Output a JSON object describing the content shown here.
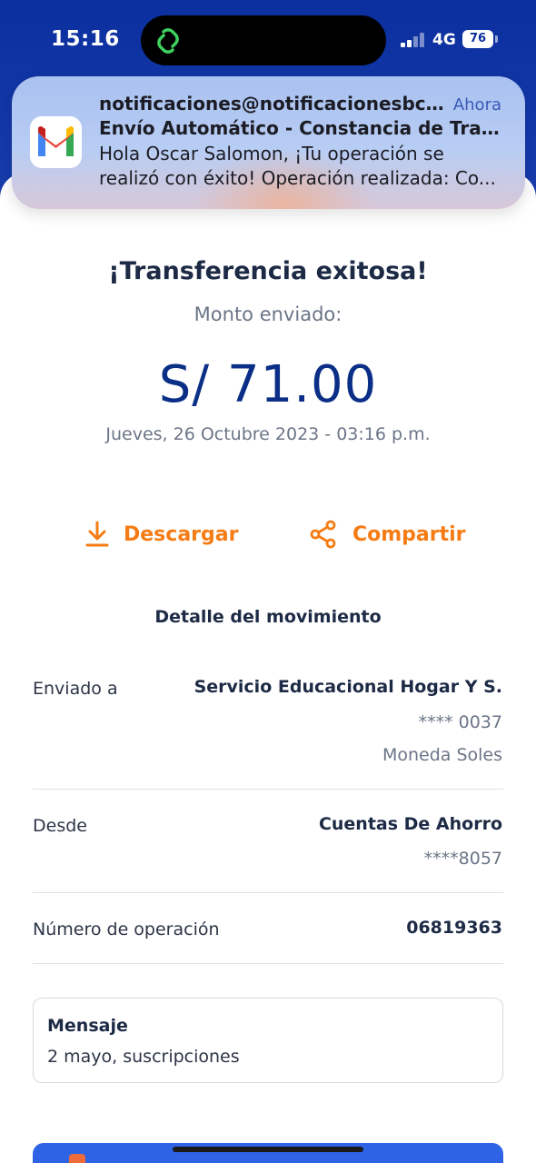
{
  "status_bar": {
    "time": "15:16",
    "network": "4G",
    "battery": "76"
  },
  "notification": {
    "app_icon": "gmail-icon",
    "from": "notificaciones@notificacionesbc...",
    "time": "Ahora",
    "subject": "Envío Automático - Constancia de Tran...",
    "body_line1": "Hola Oscar Salomon, ¡Tu operación se",
    "body_line2": "realizó con éxito! Operación realizada: Co..."
  },
  "receipt": {
    "title": "¡Transferencia exitosa!",
    "amount_label": "Monto enviado:",
    "amount": "S/ 71.00",
    "datetime": "Jueves, 26 Octubre 2023 - 03:16 p.m."
  },
  "actions": {
    "download_label": "Descargar",
    "share_label": "Compartir"
  },
  "detail": {
    "section_title": "Detalle del movimiento",
    "sent_to_label": "Enviado a",
    "sent_to_name": "Servicio Educacional Hogar Y S.",
    "sent_to_account": "**** 0037",
    "sent_to_currency": "Moneda Soles",
    "from_label": "Desde",
    "from_name": "Cuentas De Ahorro",
    "from_account": "****8057",
    "operation_label": "Número de operación",
    "operation_number": "06819363"
  },
  "message": {
    "title": "Mensaje",
    "text": "2 mayo, suscripciones"
  },
  "colors": {
    "brand_blue": "#0b2f9e",
    "amount_blue": "#0b2f87",
    "accent_orange": "#f57c14"
  }
}
